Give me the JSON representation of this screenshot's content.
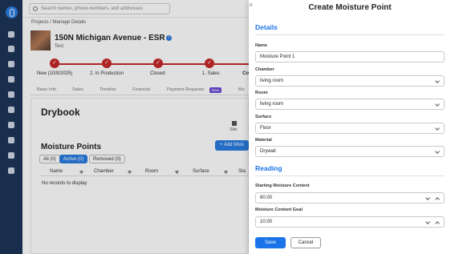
{
  "app": {
    "search_placeholder": "Search names, phone-numbers, and addresses",
    "breadcrumb": "Projects / Manage Details",
    "project_title": "150N Michigan Avenue - ESR",
    "project_subtitle": "Test",
    "stages": [
      {
        "label": "New (10/9/2025)"
      },
      {
        "label": "2. In Production"
      },
      {
        "label": "Closed"
      },
      {
        "label": "1. Sales"
      },
      {
        "label": "Co"
      }
    ],
    "tabs": [
      {
        "label": "Basic Info"
      },
      {
        "label": "Sales"
      },
      {
        "label": "Timeline"
      },
      {
        "label": "Financial"
      },
      {
        "label": "Payment Requests"
      },
      {
        "label": "Mo"
      }
    ],
    "new_badge": "New",
    "drybook_title": "Drybook",
    "site_label": "Site",
    "moisture_points_title": "Moisture Points",
    "add_button": "+ Add Mois",
    "filters": [
      "All (0)",
      "Active (0)",
      "Removed (0)"
    ],
    "columns": [
      "Name",
      "Chamber",
      "Room",
      "Surface",
      "Sta"
    ],
    "empty_text": "No records to display"
  },
  "modal": {
    "close_glyph": "×",
    "title": "Create Moisture Point",
    "details_title": "Details",
    "name_label": "Name",
    "name_value": "Moisture Point 1",
    "chamber_label": "Chamber",
    "chamber_value": "living room",
    "room_label": "Room",
    "room_value": "living room",
    "surface_label": "Surface",
    "surface_value": "Floor",
    "material_label": "Material",
    "material_value": "Drywall",
    "reading_title": "Reading",
    "start_label": "Starting Moisture Content",
    "start_value": "60.00",
    "goal_label": "Moisture Content Goal",
    "goal_value": "10.00",
    "save_label": "Save",
    "cancel_label": "Cancel"
  },
  "colors": {
    "accent": "#1a73e8",
    "sidebar": "#1d3557",
    "stage_done": "#c62828",
    "badge_new": "#6b4bd6"
  }
}
